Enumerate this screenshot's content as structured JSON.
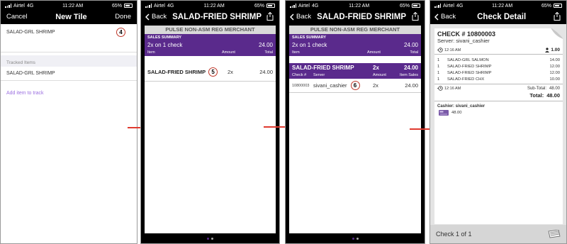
{
  "status": {
    "carrier": "Airtel",
    "network": "4G",
    "time": "11:22 AM",
    "battery": "65%"
  },
  "screen1": {
    "nav_left": "Cancel",
    "title": "New Tile",
    "nav_right": "Done",
    "first_item": "SALAD-GRL SHRIMP",
    "first_badge": "4",
    "section_header": "Tracked Items",
    "tracked_item": "SALAD-GRL SHRIMP",
    "add_link": "Add item to track"
  },
  "screen2": {
    "back": "Back",
    "title": "SALAD-FRIED SHRIMP",
    "merchant": "PULSE NON-ASM REG MERCHANT",
    "summary_caption": "SALES SUMMARY",
    "summary_desc": "2x on 1 check",
    "summary_total": "24.00",
    "col_item": "Item",
    "col_amount": "Amount",
    "col_total": "Total",
    "row": {
      "item": "SALAD-FRIED SHRIMP",
      "badge": "5",
      "amount": "2x",
      "total": "24.00"
    }
  },
  "screen3": {
    "back": "Back",
    "title": "SALAD-FRIED SHRIMP",
    "merchant": "PULSE NON-ASM REG MERCHANT",
    "summary_caption": "SALES SUMMARY",
    "summary_desc": "2x on 1 check",
    "summary_total": "24.00",
    "col_item": "Item",
    "col_amount": "Amount",
    "col_total": "Total",
    "group": {
      "name": "SALAD-FRIED SHRIMP",
      "qty": "2x",
      "total": "24.00"
    },
    "sub_cols": {
      "check": "Check #",
      "server": "Server",
      "amount": "Amount",
      "sales": "Item Sales"
    },
    "row": {
      "check": "10800003",
      "server": "sivani_cashier",
      "badge": "6",
      "amount": "2x",
      "sales": "24.00"
    }
  },
  "screen4": {
    "back": "Back",
    "title": "Check Detail",
    "check_no": "CHECK # 10800003",
    "server": "Server: sivani_cashier",
    "open_time": "12:16 AM",
    "guests": "1.00",
    "items": [
      {
        "qty": "1",
        "name": "SALAD-GRL SALMON",
        "price": "14.00"
      },
      {
        "qty": "1",
        "name": "SALAD-FRIED SHRIMP",
        "price": "12.00"
      },
      {
        "qty": "1",
        "name": "SALAD-FRIED SHRIMP",
        "price": "12.00"
      },
      {
        "qty": "1",
        "name": "SALAD-FRIED CHX",
        "price": "10.00"
      }
    ],
    "close_time": "12:16 AM",
    "subtotal_label": "Sub-Total:",
    "subtotal": "48.00",
    "total_label": "Total:",
    "total": "48.00",
    "cashier": "Cashier: sivani_cashier",
    "payment": "48.00",
    "footer": "Check 1 of 1"
  },
  "colors": {
    "purple": "#5a2a8c",
    "link": "#9b6fe0",
    "arrow": "#e03a2f"
  }
}
